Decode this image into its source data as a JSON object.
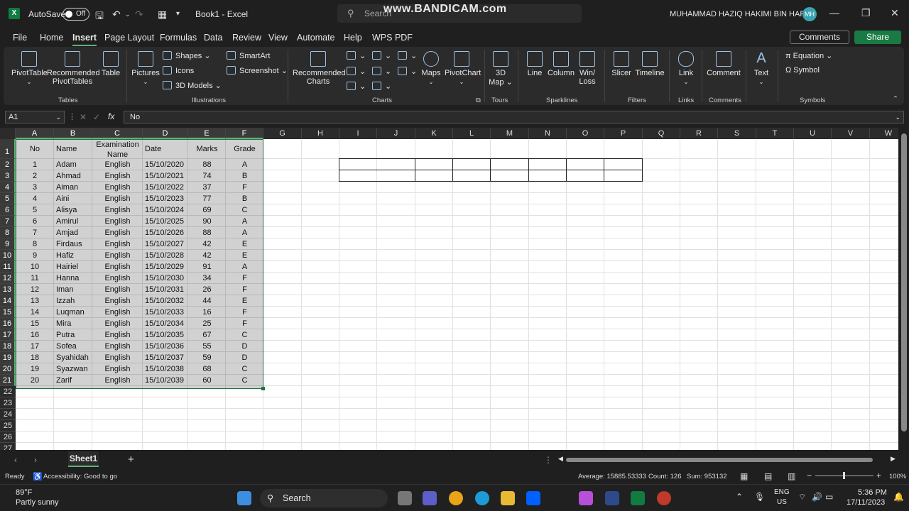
{
  "app": {
    "autosave_label": "AutoSave",
    "autosave_state": "Off",
    "doc_title": "Book1  -  Excel",
    "search_placeholder": "Search",
    "watermark": "www.BANDICAM.com",
    "user_name": "MUHAMMAD HAZIQ HAKIMI BIN HARIS",
    "user_initials": "MH"
  },
  "menu": {
    "items": [
      "File",
      "Home",
      "Insert",
      "Page Layout",
      "Formulas",
      "Data",
      "Review",
      "View",
      "Automate",
      "Help",
      "WPS PDF"
    ],
    "active": "Insert",
    "comments_label": "Comments",
    "share_label": "Share"
  },
  "ribbon": {
    "tables": {
      "pivottable": "PivotTable",
      "recommended1": "Recommended",
      "recommended2": "PivotTables",
      "table": "Table",
      "group": "Tables"
    },
    "illustrations": {
      "pictures": "Pictures",
      "shapes": "Shapes",
      "icons": "Icons",
      "models": "3D Models",
      "smartart": "SmartArt",
      "screenshot": "Screenshot",
      "group": "Illustrations"
    },
    "charts": {
      "rec1": "Recommended",
      "rec2": "Charts",
      "maps": "Maps",
      "pivotchart": "PivotChart",
      "group": "Charts"
    },
    "tours": {
      "map1": "3D",
      "map2": "Map",
      "group": "Tours"
    },
    "sparklines": {
      "line": "Line",
      "column": "Column",
      "winloss1": "Win/",
      "winloss2": "Loss",
      "group": "Sparklines"
    },
    "filters": {
      "slicer": "Slicer",
      "timeline": "Timeline",
      "group": "Filters"
    },
    "links": {
      "link": "Link",
      "group": "Links"
    },
    "comments": {
      "comment": "Comment",
      "group": "Comments"
    },
    "text": {
      "text": "Text"
    },
    "symbols": {
      "equation": "Equation",
      "symbol": "Symbol",
      "group": "Symbols"
    }
  },
  "formula_bar": {
    "name_box": "A1",
    "fx": "fx",
    "content": "No"
  },
  "columns": [
    "A",
    "B",
    "C",
    "D",
    "E",
    "F",
    "G",
    "H",
    "I",
    "J",
    "K",
    "L",
    "M",
    "N",
    "O",
    "P",
    "Q",
    "R",
    "S",
    "T",
    "U",
    "V",
    "W"
  ],
  "row_numbers": [
    "1",
    "2",
    "3",
    "4",
    "5",
    "6",
    "7",
    "8",
    "9",
    "10",
    "11",
    "12",
    "13",
    "14",
    "15",
    "16",
    "17",
    "18",
    "19",
    "20",
    "21",
    "22",
    "23",
    "24",
    "25",
    "26",
    "27"
  ],
  "table": {
    "headers": [
      "No",
      "Name",
      "Examination Name",
      "Date",
      "Marks",
      "Grade"
    ],
    "header_c_line1": "Examination",
    "header_c_line2": "Name",
    "rows": [
      [
        "1",
        "Adam",
        "English",
        "15/10/2020",
        "88",
        "A"
      ],
      [
        "2",
        "Ahmad",
        "English",
        "15/10/2021",
        "74",
        "B"
      ],
      [
        "3",
        "Aiman",
        "English",
        "15/10/2022",
        "37",
        "F"
      ],
      [
        "4",
        "Aini",
        "English",
        "15/10/2023",
        "77",
        "B"
      ],
      [
        "5",
        "Alisya",
        "English",
        "15/10/2024",
        "69",
        "C"
      ],
      [
        "6",
        "Amirul",
        "English",
        "15/10/2025",
        "90",
        "A"
      ],
      [
        "7",
        "Amjad",
        "English",
        "15/10/2026",
        "88",
        "A"
      ],
      [
        "8",
        "Firdaus",
        "English",
        "15/10/2027",
        "42",
        "E"
      ],
      [
        "9",
        "Hafiz",
        "English",
        "15/10/2028",
        "42",
        "E"
      ],
      [
        "10",
        "Hairiel",
        "English",
        "15/10/2029",
        "91",
        "A"
      ],
      [
        "11",
        "Hanna",
        "English",
        "15/10/2030",
        "34",
        "F"
      ],
      [
        "12",
        "Iman",
        "English",
        "15/10/2031",
        "26",
        "F"
      ],
      [
        "13",
        "Izzah",
        "English",
        "15/10/2032",
        "44",
        "E"
      ],
      [
        "14",
        "Luqman",
        "English",
        "15/10/2033",
        "16",
        "F"
      ],
      [
        "15",
        "Mira",
        "English",
        "15/10/2034",
        "25",
        "F"
      ],
      [
        "16",
        "Putra",
        "English",
        "15/10/2035",
        "67",
        "C"
      ],
      [
        "17",
        "Sofea",
        "English",
        "15/10/2036",
        "55",
        "D"
      ],
      [
        "18",
        "Syahidah",
        "English",
        "15/10/2037",
        "59",
        "D"
      ],
      [
        "19",
        "Syazwan",
        "English",
        "15/10/2038",
        "68",
        "C"
      ],
      [
        "20",
        "Zarif",
        "English",
        "15/10/2039",
        "60",
        "C"
      ]
    ]
  },
  "sheet_tabs": {
    "active": "Sheet1",
    "add": "+"
  },
  "status": {
    "ready": "Ready",
    "accessibility": "Accessibility: Good to go",
    "average": "Average: 15885.53333",
    "count": "Count: 126",
    "sum": "Sum: 953132",
    "zoom": "100%"
  },
  "taskbar": {
    "temp": "89°F",
    "weather": "Partly sunny",
    "search": "Search",
    "lang1": "ENG",
    "lang2": "US",
    "time": "5:36 PM",
    "date": "17/11/2023"
  }
}
